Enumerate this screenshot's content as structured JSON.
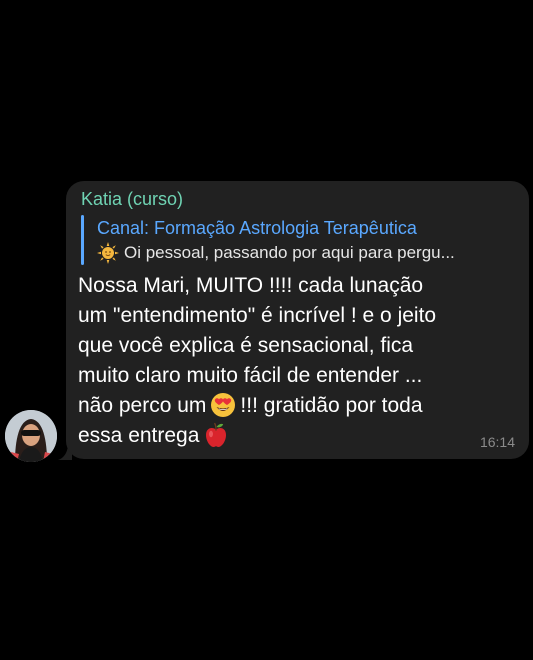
{
  "message": {
    "sender": "Katia (curso)",
    "reply": {
      "channel": "Canal: Formação Astrologia Terapêutica",
      "preview": "Oi pessoal, passando por aqui para pergu..."
    },
    "lines": [
      "Nossa Mari, MUITO !!!! cada lunação",
      "um \"entendimento\" é incrível ! e o jeito",
      "que você explica é sensacional, fica",
      "muito claro muito fácil de entender ...",
      "não perco um",
      "!!! gratidão por toda",
      "essa entrega"
    ],
    "time": "16:14"
  },
  "icons": {
    "reply_emoji": "sun-face-emoji",
    "heart_eyes_emoji": "heart-eyes-emoji",
    "apple_emoji": "red-apple-emoji"
  },
  "colors": {
    "background": "#000000",
    "bubble": "#212121",
    "sender": "#6fd3b3",
    "reply_accent": "#5aa8ff",
    "timestamp": "#8b8b8b"
  }
}
